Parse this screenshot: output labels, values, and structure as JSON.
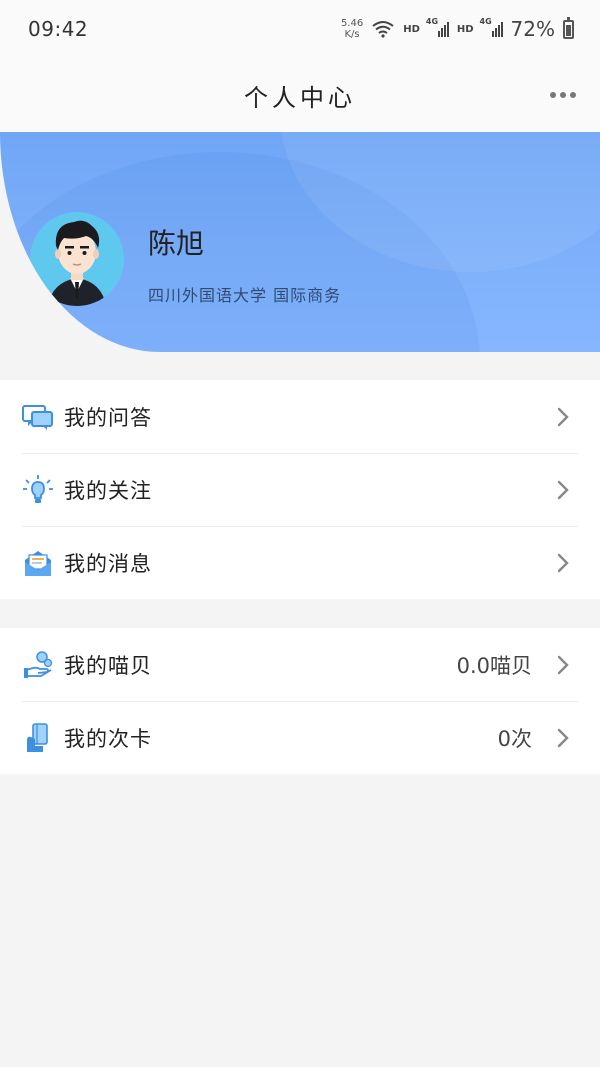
{
  "status_bar": {
    "time": "09:42",
    "net_speed_value": "5.46",
    "net_speed_unit": "K/s",
    "hd1": "HD",
    "hd2": "HD",
    "net1": "4G",
    "net2": "4G",
    "battery": "72%"
  },
  "header": {
    "title": "个人中心",
    "more_icon": "more-dots-icon"
  },
  "profile": {
    "name": "陈旭",
    "school": "四川外国语大学  国际商务",
    "avatar_icon": "cartoon-man-avatar",
    "gradient_color": "#7fb1fb"
  },
  "menu_group_1": [
    {
      "label": "我的问答",
      "icon": "chat-bubbles-icon"
    },
    {
      "label": "我的关注",
      "icon": "lightbulb-icon"
    },
    {
      "label": "我的消息",
      "icon": "envelope-icon"
    }
  ],
  "menu_group_2": [
    {
      "label": "我的喵贝",
      "value": "0.0喵贝",
      "icon": "coins-hand-icon"
    },
    {
      "label": "我的次卡",
      "value": "0次",
      "icon": "card-hand-icon"
    }
  ],
  "colors": {
    "accent_blue": "#4a90e2",
    "background": "#f4f4f4"
  }
}
